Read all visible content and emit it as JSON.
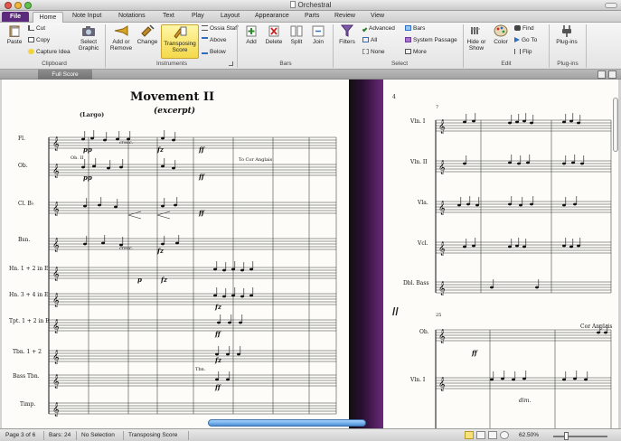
{
  "window": {
    "title": "Orchestral"
  },
  "tabs": [
    "File",
    "Home",
    "Note Input",
    "Notations",
    "Text",
    "Play",
    "Layout",
    "Appearance",
    "Parts",
    "Review",
    "View"
  ],
  "ribbon": {
    "clipboard": {
      "paste": "Paste",
      "cut": "Cut",
      "copy": "Copy",
      "capture_idea": "Capture Idea",
      "select_graphic": "Select Graphic",
      "label": "Clipboard"
    },
    "instruments": {
      "add_remove": "Add or Remove",
      "change": "Change",
      "transposing_score": "Transposing Score",
      "ossia_staff": "Ossia Staff",
      "above": "Above",
      "below": "Below",
      "label": "Instruments"
    },
    "bars": {
      "add": "Add",
      "delete": "Delete",
      "split": "Split",
      "join": "Join",
      "label": "Bars"
    },
    "select": {
      "filters": "Filters",
      "advanced": "Advanced",
      "all": "All",
      "none": "None",
      "bars": "Bars",
      "system_passage": "System Passage",
      "more": "More",
      "label": "Select"
    },
    "edit": {
      "hide_or_show": "Hide or Show",
      "color": "Color",
      "find": "Find",
      "go_to": "Go To",
      "flip": "Flip",
      "label": "Edit"
    },
    "plugins": {
      "plugins": "Plug-ins",
      "label": "Plug-ins"
    }
  },
  "score_tab": "Full Score",
  "score": {
    "title": "Movement II",
    "subtitle": "(excerpt)",
    "tempo": "(Largo)",
    "left_instruments": [
      "Fl.",
      "Ob.",
      "Cl. B♭",
      "Bsn.",
      "Hn. 1 + 2 in E",
      "Hn. 3 + 4 in E",
      "Tpt. 1 + 2 in E",
      "Tbn. 1 + 2",
      "Bass Tbn.",
      "Timp."
    ],
    "right_instruments_top": [
      "Vln. I",
      "Vln. II",
      "Vla.",
      "Vcl.",
      "Dbl. Bass"
    ],
    "right_instruments_bottom": [
      "Ob.",
      "Vln. I"
    ],
    "page_number": "4",
    "dynamics": [
      "pp",
      "pp",
      "cresc.",
      "cresc.",
      "fz",
      "fz",
      "ff",
      "ff",
      "ff",
      "p",
      "fz",
      "fz",
      "ff",
      "fz",
      "ff",
      "ff",
      "dim."
    ],
    "annotations": {
      "to_cor_anglais": "To Cor Anglais",
      "cor_anglais": "Cor Anglais",
      "ob_ii": "Ob. II",
      "tbn": "Tbn.",
      "bar_left": "7",
      "bar_right": "25"
    }
  },
  "status": {
    "page": "Page 3 of 6",
    "bars": "Bars: 24",
    "selection": "No Selection",
    "mode": "Transposing Score",
    "zoom": "62.50%"
  }
}
